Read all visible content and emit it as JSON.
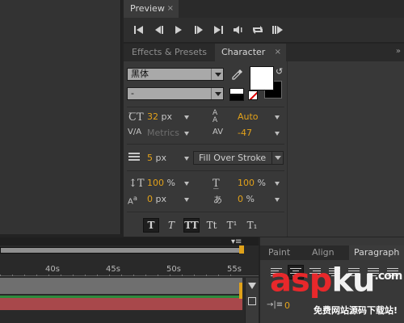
{
  "preview": {
    "tab_label": "Preview",
    "controls": [
      "first-frame-icon",
      "previous-frame-icon",
      "play-icon",
      "next-frame-icon",
      "last-frame-icon",
      "audio-icon",
      "loop-icon",
      "ram-preview-icon"
    ]
  },
  "tabs": {
    "effects_label": "Effects & Presets",
    "character_label": "Character"
  },
  "character": {
    "font_family": "黑体",
    "font_style": "-",
    "font_size": "32",
    "font_size_unit": "px",
    "leading": "Auto",
    "kerning": "Metrics",
    "tracking": "-47",
    "stroke_width": "5",
    "stroke_width_unit": "px",
    "stroke_mode": "Fill Over Stroke",
    "vertical_scale": "100",
    "horizontal_scale": "100",
    "scale_unit": "%",
    "baseline_shift": "0",
    "baseline_unit": "px",
    "tsume": "0",
    "tsume_unit": "%",
    "style_buttons": [
      "T",
      "T",
      "TT",
      "Tt",
      "T¹",
      "T₁"
    ],
    "fill_color": "#ffffff",
    "stroke_color": "#000000",
    "value_color": "#e3a21a"
  },
  "timeline": {
    "ruler_labels": [
      "40s",
      "45s",
      "50s",
      "55s"
    ],
    "menu_icon": "panel-menu-icon"
  },
  "paragraph_panel": {
    "tabs": [
      "Paint",
      "Align",
      "Paragraph"
    ],
    "indent_value": "0"
  },
  "watermark": {
    "logo_red": "asp",
    "logo_white": "ku",
    "logo_suffix": ".com",
    "subtitle": "免费网站源码下载站!"
  }
}
